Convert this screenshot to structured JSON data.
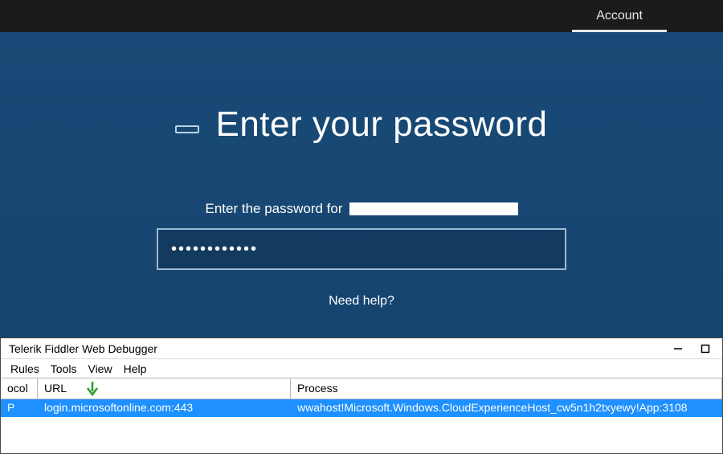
{
  "topbar": {
    "tab_label": "Account"
  },
  "main": {
    "headline": "Enter your password",
    "prompt_prefix": "Enter the password for",
    "password_mask": "••••••••••••",
    "help_link": "Need help?"
  },
  "fiddler": {
    "title": "Telerik Fiddler Web Debugger",
    "menu": {
      "rules": "Rules",
      "tools": "Tools",
      "view": "View",
      "help": "Help"
    },
    "columns": {
      "protocol": "ocol",
      "url": "URL",
      "process": "Process"
    },
    "row": {
      "protocol": "P",
      "url": "login.microsoftonline.com:443",
      "process": "wwahost!Microsoft.Windows.CloudExperienceHost_cw5n1h2txyewy!App:3108"
    }
  }
}
